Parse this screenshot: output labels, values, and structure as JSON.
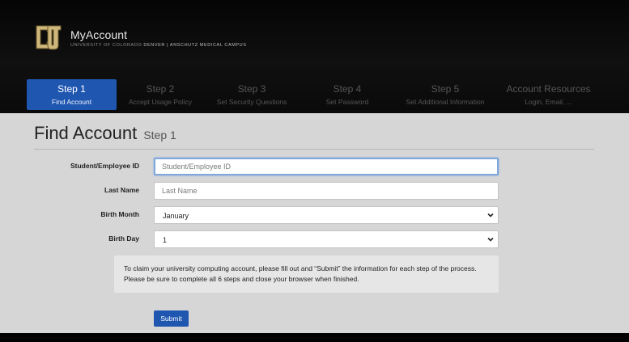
{
  "header": {
    "brand_title": "MyAccount",
    "brand_sub_prefix": "UNIVERSITY OF COLORADO",
    "brand_sub_bold": "DENVER | ANSCHUTZ MEDICAL CAMPUS"
  },
  "steps": [
    {
      "title": "Step 1",
      "subtitle": "Find Account",
      "active": true
    },
    {
      "title": "Step 2",
      "subtitle": "Accept Usage Policy",
      "active": false
    },
    {
      "title": "Step 3",
      "subtitle": "Set Security Questions",
      "active": false
    },
    {
      "title": "Step 4",
      "subtitle": "Set Password",
      "active": false
    },
    {
      "title": "Step 5",
      "subtitle": "Set Additional Information",
      "active": false
    },
    {
      "title": "Account Resources",
      "subtitle": "Login, Email, ...",
      "active": false
    }
  ],
  "page": {
    "title": "Find Account",
    "subtitle": "Step 1"
  },
  "form": {
    "student_id": {
      "label": "Student/Employee ID",
      "placeholder": "Student/Employee ID",
      "value": ""
    },
    "last_name": {
      "label": "Last Name",
      "placeholder": "Last Name",
      "value": ""
    },
    "birth_month": {
      "label": "Birth Month",
      "value": "January"
    },
    "birth_day": {
      "label": "Birth Day",
      "value": "1"
    },
    "submit_label": "Submit"
  },
  "info": {
    "line1": "To claim your university computing account, please fill out and “Submit” the information for each step of the process.",
    "line2": "Please be sure to complete all 6 steps and close your browser when finished."
  },
  "colors": {
    "accent": "#1f56b0",
    "gold": "#cfb87c"
  },
  "icons": {
    "logo": "cu-logo-icon",
    "dropdown": "chevron-down-icon"
  }
}
